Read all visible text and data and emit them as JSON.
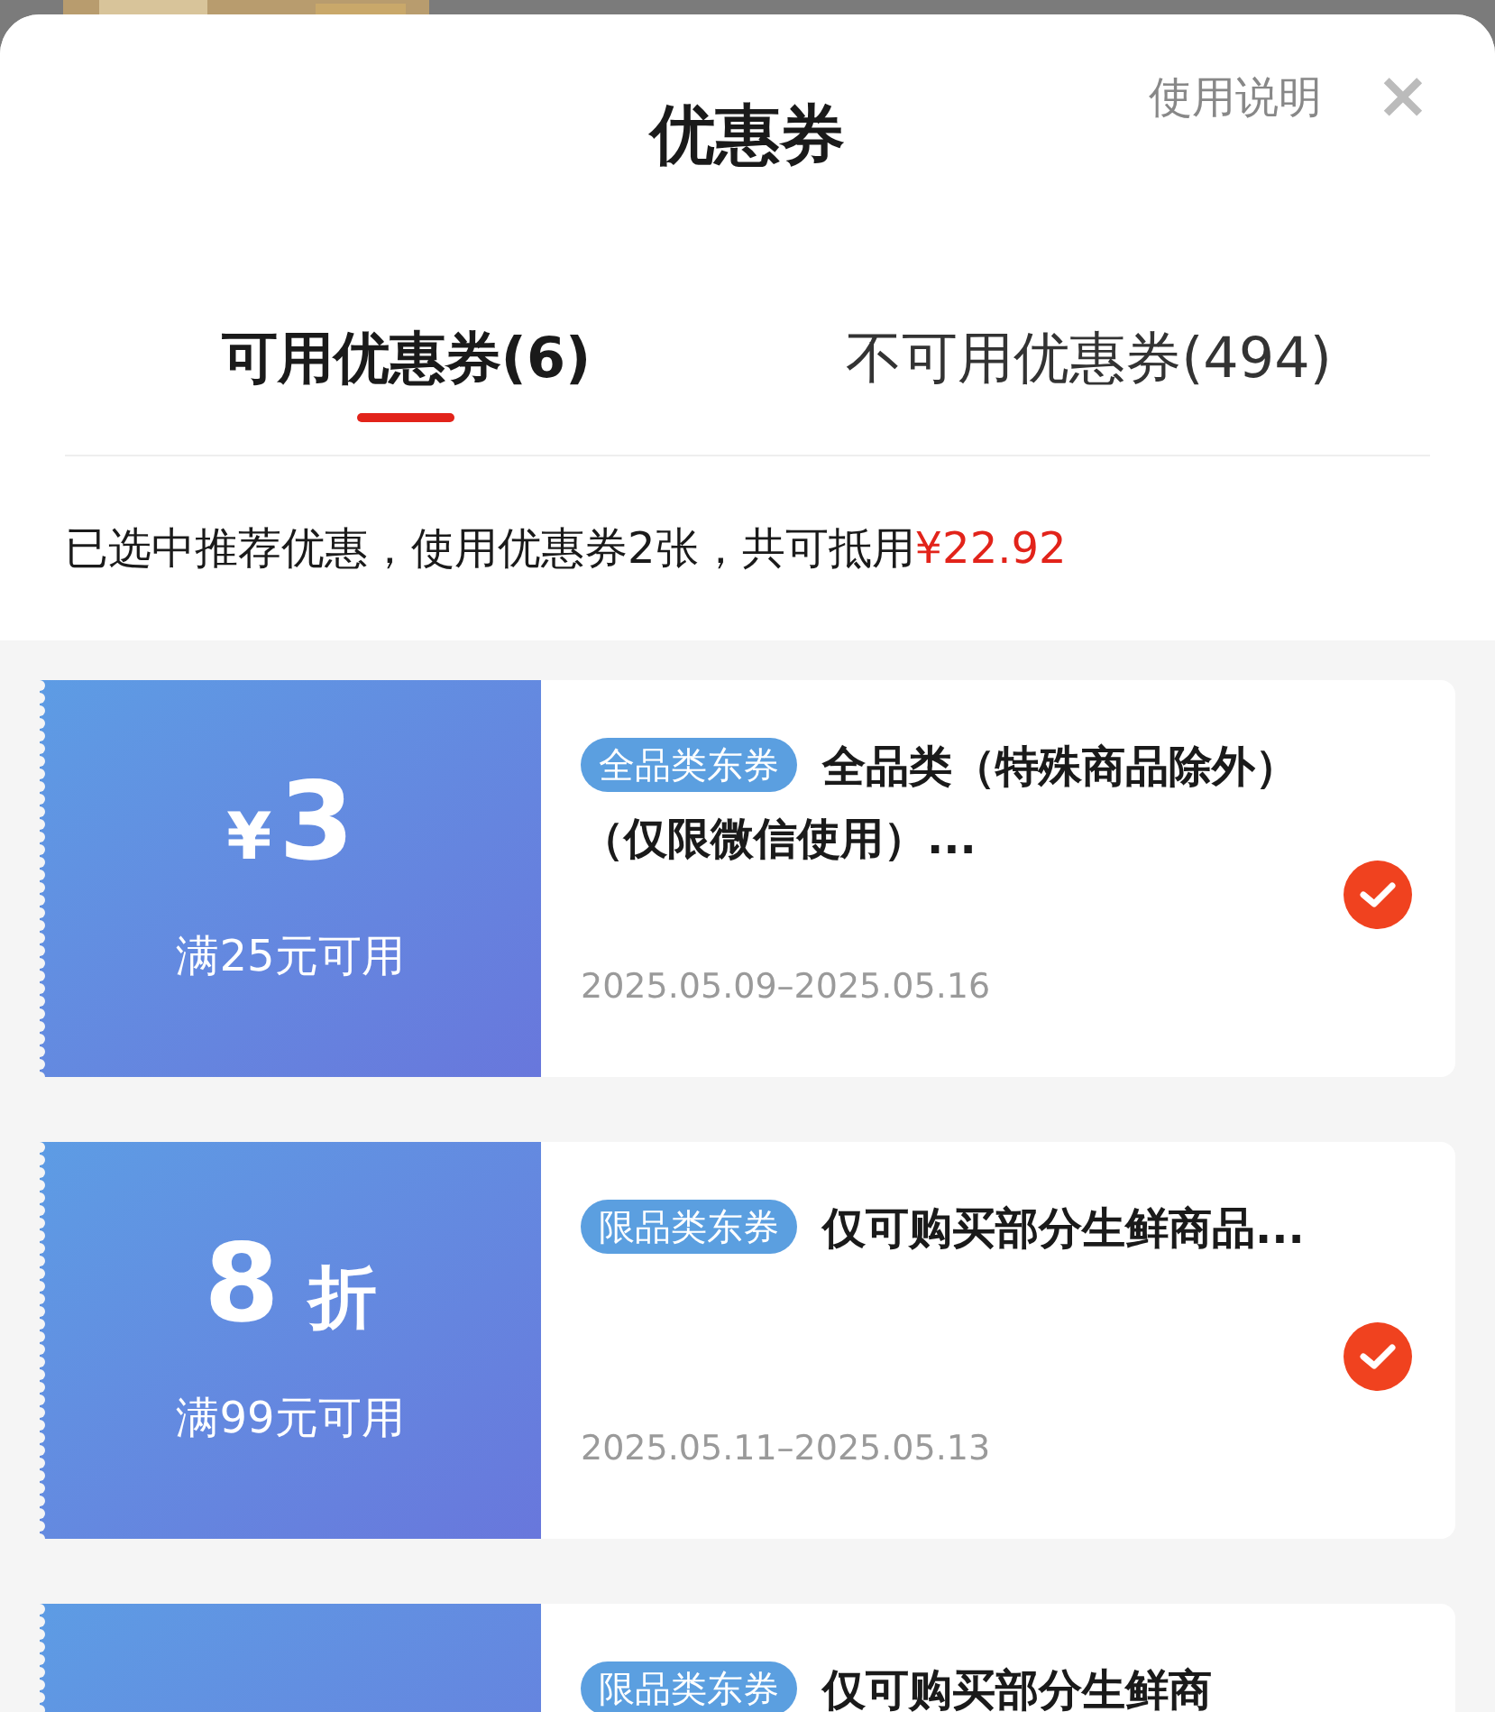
{
  "sheet": {
    "title": "优惠券",
    "help_link": "使用说明",
    "close": "×"
  },
  "tabs": [
    {
      "label": "可用优惠券(6)",
      "selected": true
    },
    {
      "label": "不可用优惠券(494)",
      "selected": false
    }
  ],
  "summary": {
    "text": "已选中推荐优惠，使用优惠券2张，共可抵用",
    "amount": "¥22.92"
  },
  "coupons": [
    {
      "kind": "cash",
      "symbol": "¥",
      "value": "3",
      "condition": "满25元可用",
      "tag": "全品类东券",
      "title": "全品类（特殊商品除外）（仅限微信使用）...",
      "date": "2025.05.09–2025.05.16",
      "selected": true
    },
    {
      "kind": "discount",
      "value": "8",
      "unit": "折",
      "condition": "满99元可用",
      "tag": "限品类东券",
      "title": "仅可购买部分生鲜商品...",
      "date": "2025.05.11–2025.05.13",
      "selected": true
    },
    {
      "kind": "partial",
      "tag": "限品类东券",
      "title": "仅可购买部分生鲜商"
    }
  ]
}
